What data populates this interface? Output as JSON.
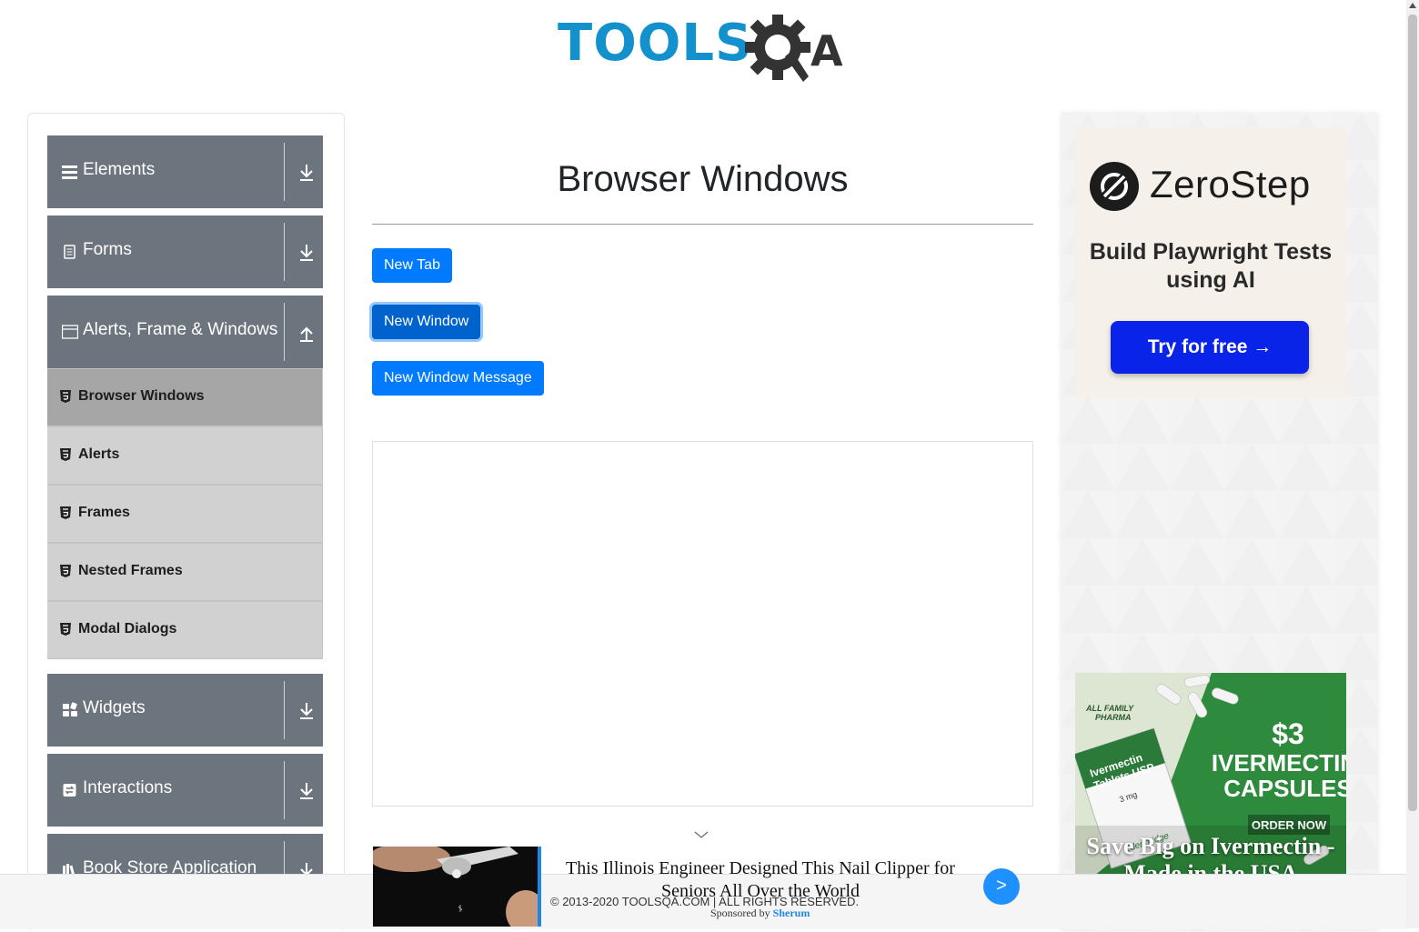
{
  "header": {
    "logo_text": "TOOLSQA",
    "logo_left": "TOOLS",
    "logo_right": "QA"
  },
  "sidebar": {
    "groups": [
      {
        "label": "Elements",
        "icon": "hamburger-icon",
        "state": "collapsed"
      },
      {
        "label": "Forms",
        "icon": "document-icon",
        "state": "collapsed"
      },
      {
        "label": "Alerts, Frame & Windows",
        "icon": "window-icon",
        "state": "expanded"
      },
      {
        "label": "Widgets",
        "icon": "widgets-icon",
        "state": "collapsed"
      },
      {
        "label": "Interactions",
        "icon": "interactions-icon",
        "state": "collapsed"
      },
      {
        "label": "Book Store Application",
        "icon": "bookstore-icon",
        "state": "collapsed"
      }
    ],
    "sub_items": [
      {
        "label": "Browser Windows",
        "active": true
      },
      {
        "label": "Alerts",
        "active": false
      },
      {
        "label": "Frames",
        "active": false
      },
      {
        "label": "Nested Frames",
        "active": false
      },
      {
        "label": "Modal Dialogs",
        "active": false
      }
    ]
  },
  "main": {
    "title": "Browser Windows",
    "buttons": {
      "new_tab": "New Tab",
      "new_window": "New Window",
      "new_window_message": "New Window Message"
    }
  },
  "ads": {
    "zerostep": {
      "brand": "ZeroStep",
      "tagline": "Build Playwright Tests using AI",
      "cta": "Try for free →"
    },
    "ivermectin": {
      "pharmacy": "ALL FAMILY PHARMA",
      "box_label": "Ivermectin Tablets USP",
      "box_dose": "3 mg",
      "box_maker": "Edenbridge",
      "price": "$3",
      "drug": "IVERMECTIN",
      "form": "CAPSULES",
      "order": "ORDER NOW",
      "headline": "Save Big on Ivermectin - Made in the USA"
    }
  },
  "footer": {
    "copyright": "© 2013-2020 TOOLSQA.COM | ALL RIGHTS RESERVED.",
    "sponsor_headline": "This Illinois Engineer Designed This Nail Clipper for Seniors All Over the World",
    "sponsored_prefix": "Sponsored by",
    "sponsor_name": "Sherum",
    "next_label": ">"
  },
  "colors": {
    "primary": "#007bff",
    "sidebar_header": "#6c757d",
    "sub_item": "#d1d1d1",
    "sub_item_active": "#a6a6a6",
    "logo_blue": "#1391cc"
  }
}
